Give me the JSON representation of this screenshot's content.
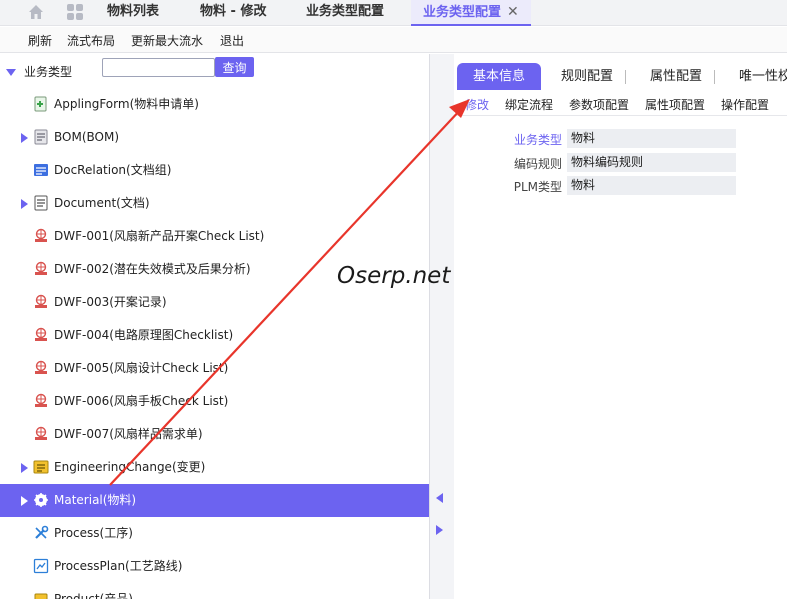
{
  "top_tabs": [
    {
      "label": "物料列表"
    },
    {
      "label": "物料 - 修改"
    },
    {
      "label": "业务类型配置"
    },
    {
      "label": "业务类型配置",
      "active": true
    }
  ],
  "toolbar": {
    "refresh": "刷新",
    "flow_layout": "流式布局",
    "update_max_serial": "更新最大流水",
    "exit": "退出"
  },
  "tree": {
    "root_label": "业务类型",
    "search_placeholder": "",
    "search_button": "查询",
    "nodes": [
      {
        "label": "ApplingForm(物料申请单)",
        "icon": "form-plus-icon",
        "expandable": false
      },
      {
        "label": "BOM(BOM)",
        "icon": "bom-icon",
        "expandable": true
      },
      {
        "label": "DocRelation(文档组)",
        "icon": "doc-relation-icon",
        "expandable": false
      },
      {
        "label": "Document(文档)",
        "icon": "document-icon",
        "expandable": true
      },
      {
        "label": "DWF-001(风扇新产品开案Check List)",
        "icon": "fan-logo-icon",
        "expandable": false
      },
      {
        "label": "DWF-002(潜在失效模式及后果分析)",
        "icon": "fan-logo-icon",
        "expandable": false
      },
      {
        "label": "DWF-003(开案记录)",
        "icon": "fan-logo-icon",
        "expandable": false
      },
      {
        "label": "DWF-004(电路原理图Checklist)",
        "icon": "fan-logo-icon",
        "expandable": false
      },
      {
        "label": "DWF-005(风扇设计Check List)",
        "icon": "fan-logo-icon",
        "expandable": false
      },
      {
        "label": "DWF-006(风扇手板Check List)",
        "icon": "fan-logo-icon",
        "expandable": false
      },
      {
        "label": "DWF-007(风扇样品需求单)",
        "icon": "fan-logo-icon",
        "expandable": false
      },
      {
        "label": "EngineeringChange(变更)",
        "icon": "change-icon",
        "expandable": true
      },
      {
        "label": "Material(物料)",
        "icon": "gear-icon",
        "expandable": true,
        "selected": true
      },
      {
        "label": "Process(工序)",
        "icon": "tools-icon",
        "expandable": false
      },
      {
        "label": "ProcessPlan(工艺路线)",
        "icon": "process-plan-icon",
        "expandable": false
      },
      {
        "label": "Product(产品)",
        "icon": "product-icon",
        "expandable": false
      }
    ]
  },
  "right_panel": {
    "tabs": [
      {
        "label": "基本信息",
        "active": true
      },
      {
        "label": "规则配置"
      },
      {
        "label": "属性配置"
      },
      {
        "label": "唯一性校"
      }
    ],
    "subtabs": [
      {
        "label": "修改",
        "active": true
      },
      {
        "label": "绑定流程"
      },
      {
        "label": "参数项配置"
      },
      {
        "label": "属性项配置"
      },
      {
        "label": "操作配置"
      }
    ],
    "fields": [
      {
        "label": "业务类型",
        "value": "物料",
        "required": true
      },
      {
        "label": "编码规则",
        "value": "物料编码规则"
      },
      {
        "label": "PLM类型",
        "value": "物料"
      }
    ]
  },
  "watermark": "Oserp.net",
  "colors": {
    "accent": "#6c63f0",
    "annotation_arrow": "#e8352b"
  }
}
